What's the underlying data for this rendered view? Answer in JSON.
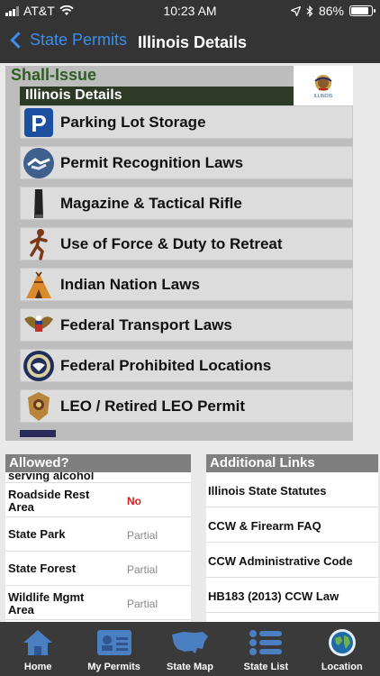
{
  "status": {
    "carrier": "AT&T",
    "time": "10:23 AM",
    "battery": "86%"
  },
  "nav": {
    "back_label": "State Permits",
    "title": "Illinois Details"
  },
  "header": {
    "classification": "Shall-Issue",
    "section_title": "Illinois Details",
    "flag_caption": "ILLINOIS"
  },
  "menu": [
    {
      "label": "Parking Lot Storage",
      "icon": "parking-icon"
    },
    {
      "label": "Permit Recognition Laws",
      "icon": "handshake-icon"
    },
    {
      "label": "Magazine & Tactical Rifle",
      "icon": "magazine-icon"
    },
    {
      "label": "Use of Force & Duty to Retreat",
      "icon": "running-man-icon"
    },
    {
      "label": "Indian Nation Laws",
      "icon": "tepee-icon"
    },
    {
      "label": "Federal Transport Laws",
      "icon": "eagle-seal-icon"
    },
    {
      "label": "Federal Prohibited Locations",
      "icon": "presidential-seal-icon"
    },
    {
      "label": "LEO / Retired LEO Permit",
      "icon": "badge-icon"
    }
  ],
  "allowed": {
    "title": "Allowed?",
    "partial_row": "serving alcohol",
    "rows": [
      {
        "place": "Roadside Rest Area",
        "status": "No"
      },
      {
        "place": "State Park",
        "status": "Partial"
      },
      {
        "place": "State Forest",
        "status": "Partial"
      },
      {
        "place": "Wildlife Mgmt Area",
        "status": "Partial"
      }
    ]
  },
  "links": {
    "title": "Additional Links",
    "items": [
      "Illinois State Statutes",
      "CCW & Firearm FAQ",
      "CCW Administrative Code",
      "HB183 (2013) CCW Law"
    ]
  },
  "tabs": [
    {
      "label": "Home",
      "icon": "home-icon"
    },
    {
      "label": "My Permits",
      "icon": "id-card-icon"
    },
    {
      "label": "State Map",
      "icon": "us-map-icon"
    },
    {
      "label": "State List",
      "icon": "list-icon"
    },
    {
      "label": "Location",
      "icon": "globe-icon"
    }
  ],
  "colors": {
    "accent": "#3b8ef0",
    "shall_issue": "#2f5d24",
    "no": "#cf1f1f",
    "tab_icon": "#4a7fc1"
  }
}
